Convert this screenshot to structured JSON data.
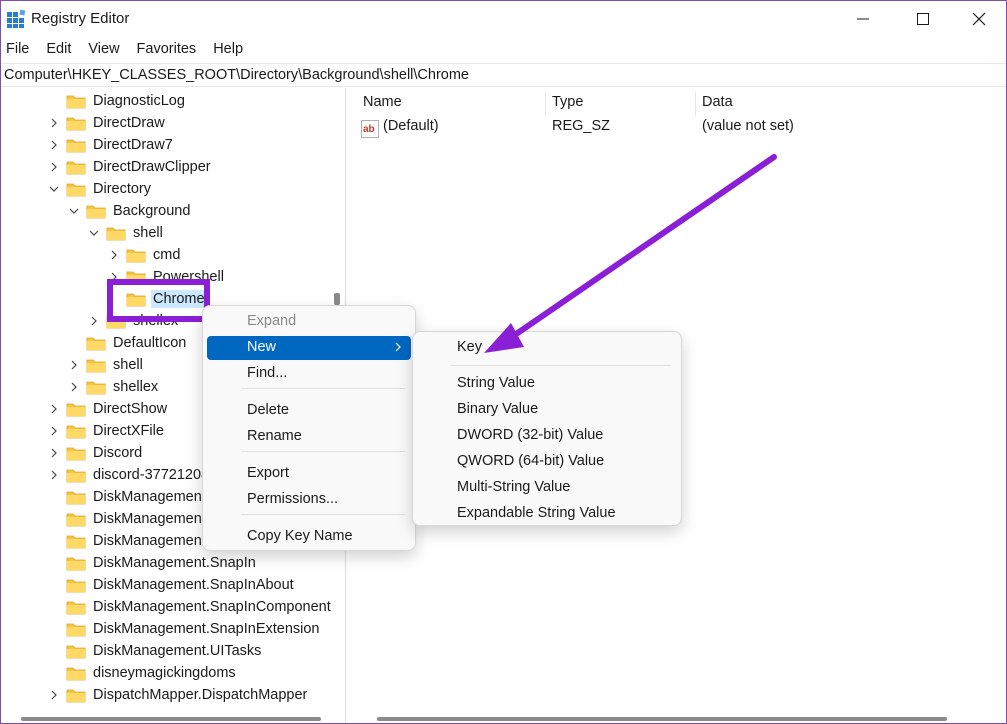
{
  "window": {
    "title": "Registry Editor",
    "accent_highlight": "#8b1fd6",
    "selection_color": "#cce8ff",
    "menu_active_color": "#0067c0"
  },
  "menubar": [
    "File",
    "Edit",
    "View",
    "Favorites",
    "Help"
  ],
  "address": "Computer\\HKEY_CLASSES_ROOT\\Directory\\Background\\shell\\Chrome",
  "tree": [
    {
      "label": "DiagnosticLog",
      "expander": "none"
    },
    {
      "label": "DirectDraw",
      "expander": "collapsed"
    },
    {
      "label": "DirectDraw7",
      "expander": "collapsed"
    },
    {
      "label": "DirectDrawClipper",
      "expander": "collapsed"
    },
    {
      "label": "Directory",
      "expander": "expanded"
    },
    {
      "label": "Background",
      "expander": "expanded"
    },
    {
      "label": "shell",
      "expander": "expanded"
    },
    {
      "label": "cmd",
      "expander": "collapsed"
    },
    {
      "label": "Powershell",
      "expander": "collapsed"
    },
    {
      "label": "Chrome",
      "expander": "none",
      "selected": true
    },
    {
      "label": "shellex",
      "expander": "collapsed"
    },
    {
      "label": "DefaultIcon",
      "expander": "none"
    },
    {
      "label": "shell",
      "expander": "collapsed"
    },
    {
      "label": "shellex",
      "expander": "collapsed"
    },
    {
      "label": "DirectShow",
      "expander": "collapsed"
    },
    {
      "label": "DirectXFile",
      "expander": "collapsed"
    },
    {
      "label": "Discord",
      "expander": "collapsed"
    },
    {
      "label": "discord-37721208",
      "expander": "collapsed"
    },
    {
      "label": "DiskManagement",
      "expander": "none"
    },
    {
      "label": "DiskManagement",
      "expander": "none"
    },
    {
      "label": "DiskManagement",
      "expander": "none"
    },
    {
      "label": "DiskManagement.SnapIn",
      "expander": "none"
    },
    {
      "label": "DiskManagement.SnapInAbout",
      "expander": "none"
    },
    {
      "label": "DiskManagement.SnapInComponent",
      "expander": "none"
    },
    {
      "label": "DiskManagement.SnapInExtension",
      "expander": "none"
    },
    {
      "label": "DiskManagement.UITasks",
      "expander": "none"
    },
    {
      "label": "disneymagickingdoms",
      "expander": "none"
    },
    {
      "label": "DispatchMapper.DispatchMapper",
      "expander": "collapsed"
    }
  ],
  "values": {
    "headers": {
      "name": "Name",
      "type": "Type",
      "data": "Data"
    },
    "rows": [
      {
        "name": "(Default)",
        "type": "REG_SZ",
        "data": "(value not set)",
        "icon": "string-value-icon"
      }
    ]
  },
  "context_menu": {
    "items": [
      {
        "label": "Expand",
        "state": "disabled"
      },
      {
        "label": "New",
        "state": "active",
        "submenu": true
      },
      {
        "label": "Find...",
        "state": "normal"
      },
      {
        "label": "Delete",
        "state": "normal"
      },
      {
        "label": "Rename",
        "state": "normal"
      },
      {
        "label": "Export",
        "state": "normal"
      },
      {
        "label": "Permissions...",
        "state": "normal"
      },
      {
        "label": "Copy Key Name",
        "state": "normal"
      }
    ]
  },
  "new_submenu": {
    "items": [
      "Key",
      "String Value",
      "Binary Value",
      "DWORD (32-bit) Value",
      "QWORD (64-bit) Value",
      "Multi-String Value",
      "Expandable String Value"
    ]
  }
}
